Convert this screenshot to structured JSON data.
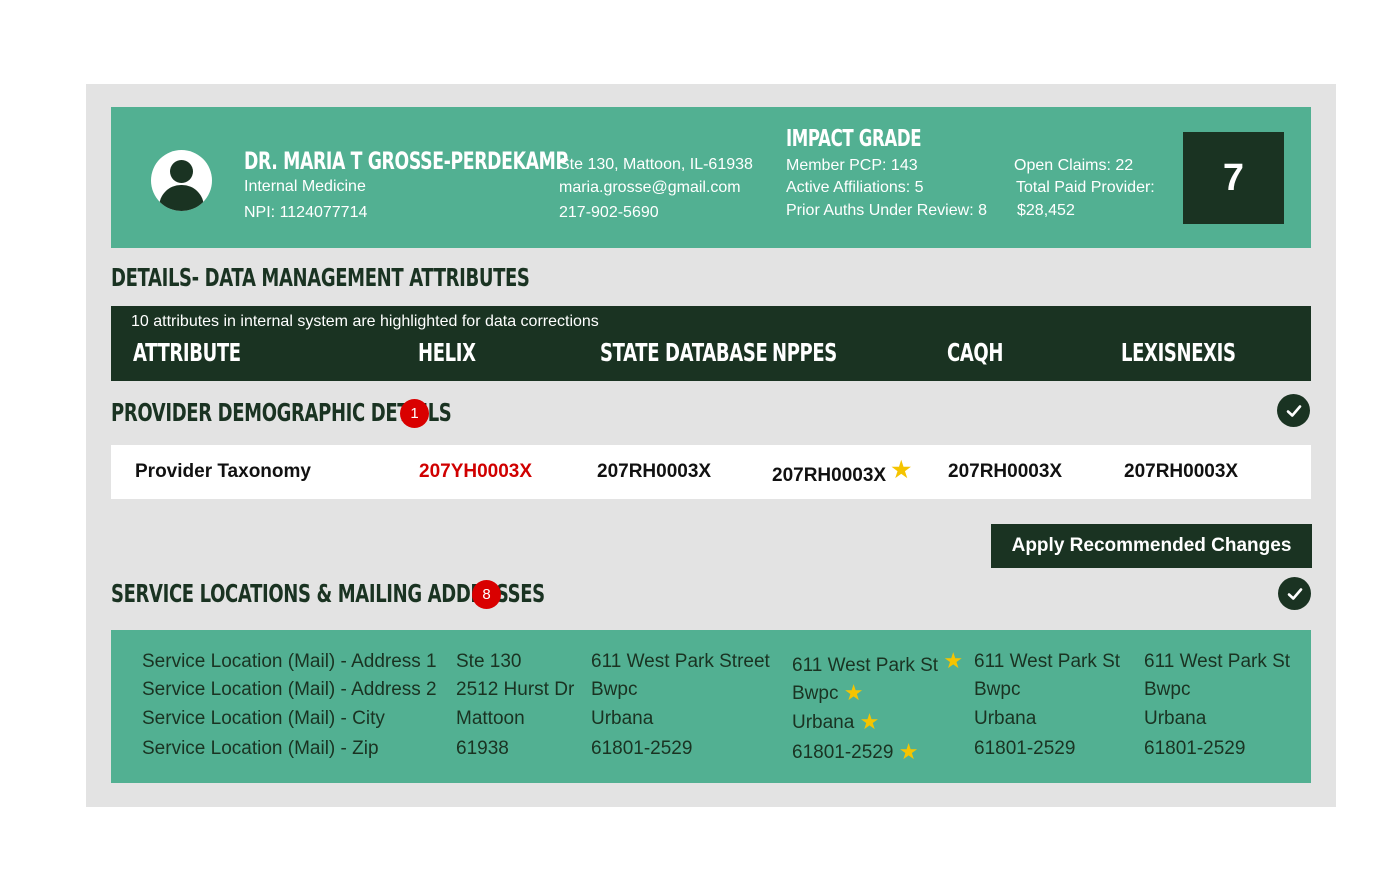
{
  "colors": {
    "green": "#52b092",
    "dark": "#1a3322",
    "panel": "#e3e3e3",
    "red": "#d00000",
    "star": "#f5c400"
  },
  "provider": {
    "name": "DR. MARIA T GROSSE-PERDEKAMP",
    "specialty": "Internal Medicine",
    "npi": "NPI: 1124077714",
    "address": "Ste 130, Mattoon, IL-61938",
    "email": "maria.grosse@gmail.com",
    "phone": "217-902-5690",
    "avatar_icon": "user-avatar-icon"
  },
  "impact": {
    "title": "IMPACT GRADE",
    "member_pcp": "Member PCP: 143",
    "active_affiliations": "Active Affiliations: 5",
    "prior_auths": "Prior Auths Under Review: 8",
    "open_claims": "Open Claims: 22",
    "total_paid_label": "Total Paid Provider:",
    "total_paid_value": "$28,452",
    "grade": "7"
  },
  "details": {
    "title": "DETAILS- DATA MANAGEMENT ATTRIBUTES",
    "note": "10 attributes in internal system are highlighted for data corrections",
    "columns": [
      "ATTRIBUTE",
      "HELIX",
      "STATE DATABASE",
      "NPPES",
      "CAQH",
      "LEXISNEXIS"
    ]
  },
  "demographic": {
    "title": "PROVIDER DEMOGRAPHIC DETAILS",
    "badge": "1",
    "check_icon": "check-circle-icon",
    "row": [
      "Provider Taxonomy",
      "207YH0003X",
      "207RH0003X",
      "207RH0003X",
      "207RH0003X",
      "207RH0003X"
    ]
  },
  "apply_button": "Apply Recommended Changes",
  "service": {
    "title": "SERVICE LOCATIONS & MAILING ADDRESSES",
    "badge": "8",
    "check_icon": "check-circle-icon",
    "rows": [
      [
        "Service Location (Mail) - Address 1",
        "Ste 130",
        "611 West Park Street",
        "611 West Park St",
        "611 West Park St",
        "611 West Park St"
      ],
      [
        "Service Location (Mail) - Address 2",
        "2512 Hurst Dr",
        "Bwpc",
        "Bwpc",
        "Bwpc",
        "Bwpc"
      ],
      [
        "Service Location (Mail) -  City",
        "Mattoon",
        "Urbana",
        "Urbana",
        "Urbana",
        "Urbana"
      ],
      [
        "Service Location (Mail) -  Zip",
        "61938",
        "61801-2529",
        "61801-2529",
        "61801-2529",
        "61801-2529"
      ]
    ],
    "star_icon": "star-icon"
  }
}
